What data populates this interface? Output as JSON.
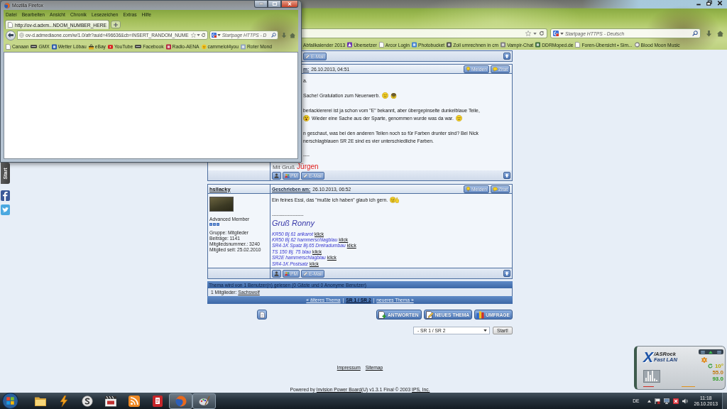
{
  "main_window": {
    "search": {
      "placeholder": "Startpage HTTPS - Deutsch"
    },
    "bookmarks": [
      "Abfallkalender 2013",
      "Übersetzer",
      "Arcor Login",
      "Photobucket",
      "Zoll umrechnen in cm",
      "Vampir-Chat",
      "DDRMoped.de",
      "Foren-Übersicht • Sim...",
      "Blood Moon Music"
    ]
  },
  "popup_window": {
    "title": "Mozilla Firefox",
    "menu": [
      "Datei",
      "Bearbeiten",
      "Ansicht",
      "Chronik",
      "Lesezeichen",
      "Extras",
      "Hilfe"
    ],
    "tabs": [
      {
        "title": "http://ov-d.adxm...NDOM_NUMBER_HERE",
        "selected": true
      }
    ],
    "address": "ov-d.admediaone.com/w/1.0/afr?auid=496636&cb=INSERT_RANDOM_NUME",
    "search": {
      "placeholder": "Startpage HTTPS - D"
    },
    "bookmarks": [
      "Canaan",
      "GMX",
      "Wetter Löbau",
      "eBay",
      "YouTube",
      "Facebook",
      "Radio-AENA",
      "cammelot4you",
      "Roter Mond"
    ]
  },
  "side_panel": {
    "tab": "Start"
  },
  "thread": {
    "previous_post": {
      "footer_buttons": [
        {
          "kind": "email",
          "label": "E-Mail"
        }
      ]
    },
    "posts": [
      {
        "date_label": "m:",
        "date": "26.10.2013, 04:51",
        "actions": [
          {
            "kind": "report",
            "label": "Melden"
          },
          {
            "kind": "quote",
            "label": "Zitat"
          }
        ],
        "body": [
          [
            [
              {
                "kind": "text",
                "text": "a."
              }
            ]
          ],
          [
            [
              {
                "kind": "text",
                "text": "Sache! Gratulation zum Neuerwerb."
              },
              {
                "kind": "smiley"
              },
              {
                "kind": "helmet"
              }
            ]
          ],
          [
            [
              {
                "kind": "text",
                "text": "berlackiererei ist ja schon vom \"E\" bekannt, aber übergepinselte dunkelblaue Teile,"
              }
            ],
            [
              {
                "kind": "shocked"
              },
              {
                "kind": "text",
                "text": "Wieder eine Sache aus der Sparte, genommen wurde was da war."
              },
              {
                "kind": "smiley"
              }
            ]
          ],
          [
            [
              {
                "kind": "text",
                "text": "n geschaut, was bei den anderen Teilen noch so für Farben drunter sind? Bei Nick"
              }
            ],
            [
              {
                "kind": "text",
                "text": "nerschlagblauen SR 2E sind es vier unterschiedliche Farben."
              }
            ]
          ]
        ],
        "signature": {
          "rule": "----",
          "greeting": "Mit Gruß",
          "name": "Jürgen"
        },
        "footer_buttons": [
          {
            "kind": "profile"
          },
          {
            "kind": "pm",
            "label": "PM"
          },
          {
            "kind": "email",
            "label": "E-Mail"
          }
        ]
      },
      {
        "author": "hsllacky",
        "date_label": "Geschrieben am:",
        "date": "26.10.2013, 06:52",
        "actions": [
          {
            "kind": "report",
            "label": "Melden"
          },
          {
            "kind": "quote",
            "label": "Zitat"
          }
        ],
        "rank": "Advanced Member",
        "stars": 3,
        "details": [
          "Gruppe: Mitglieder",
          "Beiträge: 1141",
          "Mitgliedsnummer.: 3240",
          "Mitglied seit: 25.02.2010"
        ],
        "body": [
          [
            [
              {
                "kind": "text",
                "text": "Ein feines Essi, das \"mußte ich haben\" glaub ich gern."
              },
              {
                "kind": "thumbs"
              }
            ]
          ]
        ],
        "signature": {
          "rule": "--------------------",
          "name": "Gruß Ronny",
          "links": [
            {
              "text": "KR50 Bj.61 arikarot",
              "link": "klick"
            },
            {
              "text": "KR50 Bj.62 hammerschlagblau",
              "link": "klick"
            },
            {
              "text": "SR4-1K Spatz Bj.65 Dreiradumbau",
              "link": "klick"
            },
            {
              "text": "TS 150 Bj. 75 blau",
              "link": "klick"
            },
            {
              "text": "SR2E hammerschlagblau",
              "link": "klick"
            },
            {
              "text": "SR4-1K Postsatz",
              "link": "klick"
            }
          ]
        },
        "footer_buttons": [
          {
            "kind": "profile"
          },
          {
            "kind": "pm",
            "label": "PM"
          },
          {
            "kind": "email",
            "label": "E-Mail"
          }
        ]
      }
    ]
  },
  "topic_info": {
    "readers": "Thema wird von 1 Benutzer(n) gelesen (0 Gäste und 0 Anonyme Benutzer)",
    "members_label": "1 Mitglieder:",
    "members": [
      "Sachswolf"
    ]
  },
  "topic_nav": [
    {
      "kind": "link",
      "text": "« älteres Thema"
    },
    {
      "kind": "separator",
      "text": "|"
    },
    {
      "kind": "current",
      "text": "SR 1 / SR 2"
    },
    {
      "kind": "separator",
      "text": "|"
    },
    {
      "kind": "link",
      "text": "neueres Thema »"
    }
  ],
  "topic_actions": {
    "buttons": [
      {
        "kind": "reply",
        "label": "ANTWORTEN"
      },
      {
        "kind": "new_topic",
        "label": "NEUES THEMA"
      },
      {
        "kind": "poll",
        "label": "UMFRAGE"
      }
    ]
  },
  "forum_jump": {
    "value": "- SR 1 / SR 2",
    "button": "Start!"
  },
  "page_footer": {
    "links": [
      "Impressum",
      "Sitemap"
    ],
    "powered": [
      {
        "kind": "text",
        "text": "Powered by "
      },
      {
        "kind": "link",
        "text": "Invision Power Board"
      },
      {
        "kind": "text",
        "text": "(U) v1.3.1 Final © 2003 "
      },
      {
        "kind": "link",
        "text": "IPS, Inc."
      }
    ]
  },
  "taskbar": {
    "apps": [
      {
        "running": false
      },
      {
        "running": false
      },
      {
        "running": false
      },
      {
        "running": false
      },
      {
        "running": false
      },
      {
        "running": false
      },
      {
        "running": true
      },
      {
        "running": true
      }
    ],
    "language": "DE",
    "time": "11:18",
    "date": "26.10.2013"
  },
  "gadget": {
    "logo_letter": "X",
    "brand": "/ASRock",
    "product": "Fast LAN",
    "readings": [
      {
        "text": "10°",
        "color": "#b8a800"
      },
      {
        "text": "55.0",
        "color": "#c07a12"
      },
      {
        "text": "93.0",
        "color": "#2e9a22"
      }
    ]
  }
}
